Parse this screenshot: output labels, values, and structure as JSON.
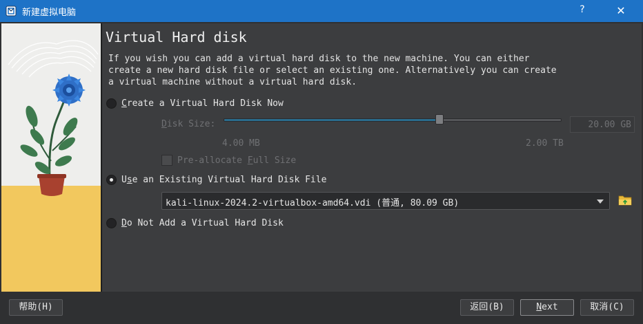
{
  "window": {
    "title": "新建虚拟电脑",
    "help_glyph": "?",
    "close_glyph": "✕"
  },
  "page": {
    "heading": "Virtual Hard disk",
    "description": "If you wish you can add a virtual hard disk to the new machine. You can either\ncreate a new hard disk file or select an existing one. Alternatively you can create\na virtual machine without a virtual hard disk."
  },
  "options": {
    "create": {
      "pre": "",
      "key": "C",
      "post": "reate a Virtual Hard Disk Now",
      "checked": false
    },
    "existing": {
      "pre": "U",
      "key": "s",
      "post": "e an Existing Virtual Hard Disk File",
      "checked": true
    },
    "none": {
      "pre": "",
      "key": "D",
      "post": "o Not Add a Virtual Hard Disk",
      "checked": false
    }
  },
  "disk_size": {
    "label_pre": "",
    "label_key": "D",
    "label_post": "isk Size:",
    "value": "20.00 GB",
    "min_label": "4.00 MB",
    "max_label": "2.00 TB",
    "slider_fraction": 0.64
  },
  "preallocate": {
    "pre": "Pre-allocate ",
    "key": "F",
    "post": "ull Size"
  },
  "existing_file": {
    "selected": "kali-linux-2024.2-virtualbox-amd64.vdi (普通, 80.09 GB)"
  },
  "buttons": {
    "help": "帮助(H)",
    "back": "返回(B)",
    "next_pre": "",
    "next_key": "N",
    "next_post": "ext",
    "cancel": "取消(C)"
  },
  "colors": {
    "titlebar": "#1e73c7",
    "panel": "#3c3d3f",
    "slider_fill": "#2a6c8c"
  },
  "icons": {
    "app": "virtualbox-icon",
    "folder": "folder-open-icon"
  }
}
